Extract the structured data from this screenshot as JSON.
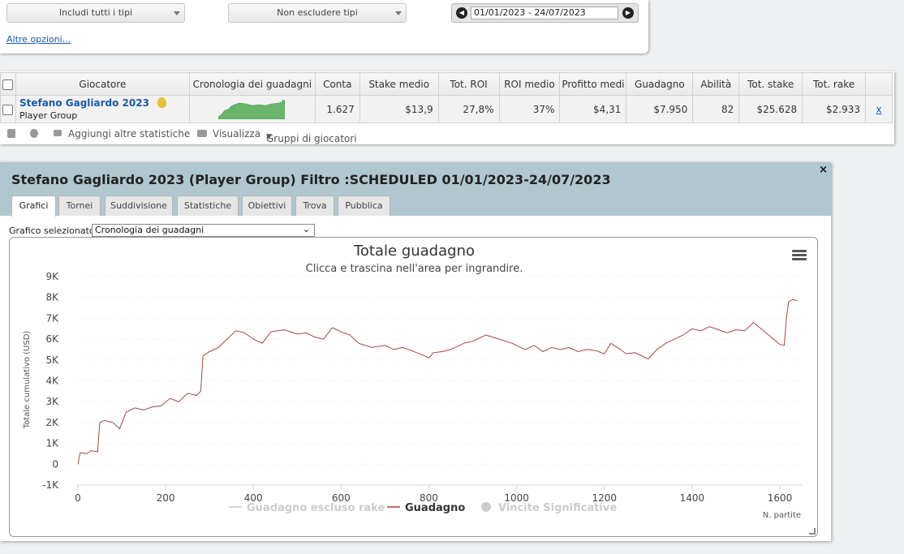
{
  "filters": {
    "include_types": "Includi tutti i tipi",
    "exclude_types": "Non escludere tipi",
    "date_range": "01/01/2023 - 24/07/2023",
    "more_options": "Altre opzioni..."
  },
  "table": {
    "headers": [
      "Giocatore",
      "Cronologia dei guadagni",
      "Conta",
      "Stake medio",
      "Tot. ROI",
      "ROI medio",
      "Profitto medi",
      "Guadagno",
      "Abilità",
      "Tot. stake",
      "Tot. rake"
    ],
    "row": {
      "player_name": "Stefano Gagliardo 2023",
      "player_group": "Player Group",
      "conta": "1.627",
      "stake_medio": "$13,9",
      "tot_roi": "27,8%",
      "roi_medio": "37%",
      "profitto_medio": "$4,31",
      "guadagno": "$7.950",
      "abilita": "82",
      "tot_stake": "$25.628",
      "tot_rake": "$2.933",
      "remove": "x"
    },
    "toolbar": {
      "add_stats": "Aggiungi altre statistiche",
      "view": "Visualizza",
      "groups": "Gruppi di giocatori"
    }
  },
  "report": {
    "title": "Stefano Gagliardo 2023 (Player Group) Filtro :SCHEDULED 01/01/2023-24/07/2023",
    "close": "×",
    "tabs": [
      "Grafici",
      "Tornei",
      "Suddivisione",
      "Statistiche",
      "Obiettivi",
      "Trova",
      "Pubblica"
    ],
    "active_tab": "Grafici",
    "graph_select_label": "Grafico selezionato",
    "graph_select_value": "Cronologia dei guadagni"
  },
  "chart_data": {
    "type": "line",
    "title": "Totale guadagno",
    "subtitle": "Clicca e trascina nell'area per ingrandire.",
    "xlabel": "N. partite",
    "ylabel": "Totale cumulativo (USD)",
    "xlim": [
      0,
      1650
    ],
    "ylim": [
      -1000,
      9000
    ],
    "x_ticks": [
      0,
      200,
      400,
      600,
      800,
      1000,
      1200,
      1400,
      1600
    ],
    "y_ticks": [
      {
        "v": -1000,
        "label": "-1K"
      },
      {
        "v": 0,
        "label": "0"
      },
      {
        "v": 1000,
        "label": "1K"
      },
      {
        "v": 2000,
        "label": "2K"
      },
      {
        "v": 3000,
        "label": "3K"
      },
      {
        "v": 4000,
        "label": "4K"
      },
      {
        "v": 5000,
        "label": "5K"
      },
      {
        "v": 6000,
        "label": "6K"
      },
      {
        "v": 7000,
        "label": "7K"
      },
      {
        "v": 8000,
        "label": "8K"
      },
      {
        "v": 9000,
        "label": "9K"
      }
    ],
    "grid": true,
    "legend": [
      {
        "name": "Guadagno escluso rake",
        "color": "#cccccc",
        "visible": false
      },
      {
        "name": "Guadagno",
        "color": "#a54545",
        "visible": true
      },
      {
        "name": "Vincite Significative",
        "color": "#cccccc",
        "visible": false
      }
    ],
    "series": [
      {
        "name": "Guadagno",
        "color": "#a54545",
        "points": [
          [
            0,
            0
          ],
          [
            5,
            550
          ],
          [
            20,
            500
          ],
          [
            30,
            650
          ],
          [
            45,
            600
          ],
          [
            50,
            2000
          ],
          [
            60,
            2100
          ],
          [
            80,
            2000
          ],
          [
            95,
            1700
          ],
          [
            110,
            2500
          ],
          [
            130,
            2700
          ],
          [
            150,
            2600
          ],
          [
            170,
            2750
          ],
          [
            190,
            2800
          ],
          [
            210,
            3150
          ],
          [
            230,
            3000
          ],
          [
            250,
            3400
          ],
          [
            270,
            3300
          ],
          [
            280,
            3500
          ],
          [
            285,
            5200
          ],
          [
            300,
            5400
          ],
          [
            320,
            5600
          ],
          [
            340,
            6000
          ],
          [
            360,
            6400
          ],
          [
            380,
            6300
          ],
          [
            400,
            6000
          ],
          [
            420,
            5800
          ],
          [
            440,
            6350
          ],
          [
            470,
            6450
          ],
          [
            500,
            6250
          ],
          [
            520,
            6300
          ],
          [
            540,
            6100
          ],
          [
            560,
            6000
          ],
          [
            580,
            6550
          ],
          [
            600,
            6350
          ],
          [
            620,
            6200
          ],
          [
            640,
            5800
          ],
          [
            670,
            5600
          ],
          [
            700,
            5700
          ],
          [
            720,
            5500
          ],
          [
            740,
            5600
          ],
          [
            760,
            5450
          ],
          [
            790,
            5200
          ],
          [
            800,
            5100
          ],
          [
            810,
            5350
          ],
          [
            830,
            5400
          ],
          [
            850,
            5500
          ],
          [
            880,
            5800
          ],
          [
            900,
            5900
          ],
          [
            930,
            6200
          ],
          [
            960,
            6000
          ],
          [
            990,
            5800
          ],
          [
            1020,
            5500
          ],
          [
            1040,
            5700
          ],
          [
            1060,
            5400
          ],
          [
            1080,
            5600
          ],
          [
            1100,
            5500
          ],
          [
            1120,
            5600
          ],
          [
            1140,
            5400
          ],
          [
            1160,
            5500
          ],
          [
            1180,
            5450
          ],
          [
            1200,
            5300
          ],
          [
            1215,
            5800
          ],
          [
            1230,
            5600
          ],
          [
            1250,
            5300
          ],
          [
            1270,
            5350
          ],
          [
            1300,
            5050
          ],
          [
            1320,
            5500
          ],
          [
            1340,
            5800
          ],
          [
            1360,
            6000
          ],
          [
            1380,
            6200
          ],
          [
            1400,
            6500
          ],
          [
            1420,
            6400
          ],
          [
            1440,
            6600
          ],
          [
            1460,
            6450
          ],
          [
            1480,
            6300
          ],
          [
            1500,
            6450
          ],
          [
            1520,
            6400
          ],
          [
            1540,
            6800
          ],
          [
            1560,
            6450
          ],
          [
            1580,
            6100
          ],
          [
            1600,
            5750
          ],
          [
            1610,
            5700
          ],
          [
            1615,
            7000
          ],
          [
            1620,
            7800
          ],
          [
            1630,
            7900
          ],
          [
            1640,
            7850
          ]
        ]
      }
    ]
  }
}
